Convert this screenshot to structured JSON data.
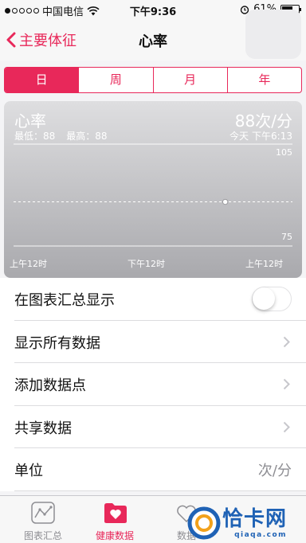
{
  "status_bar": {
    "carrier": "中国电信",
    "time": "下午9:36",
    "battery": "61%"
  },
  "nav": {
    "back_label": "主要体征",
    "title": "心率"
  },
  "segments": {
    "day": "日",
    "week": "周",
    "month": "月",
    "year": "年",
    "selected": "日"
  },
  "chart_card": {
    "title": "心率",
    "min_label": "最低：88",
    "max_label": "最高：88",
    "value": "88",
    "unit": "次/分",
    "date": "今天",
    "time": "下午6:13"
  },
  "chart_data": {
    "type": "scatter",
    "title": "心率",
    "xlabel": "",
    "ylabel": "",
    "x_ticks": [
      "上午12时",
      "下午12时",
      "上午12时"
    ],
    "ylim": [
      75,
      105
    ],
    "y_ticks": [
      "105",
      "75"
    ],
    "series": [
      {
        "name": "",
        "points": [
          {
            "x": "下午6:13",
            "y": 88
          }
        ]
      }
    ],
    "reference_line": 88,
    "grid": true,
    "colors": {
      "background_top": "#dedee0",
      "background_bottom": "#a9a9ad",
      "point": "#ffffff"
    }
  },
  "list": {
    "show_in_dashboard": "在图表汇总显示",
    "show_in_dashboard_on": false,
    "show_all_data": "显示所有数据",
    "add_data_point": "添加数据点",
    "share_data": "共享数据",
    "unit_label": "单位",
    "unit_value": "次/分"
  },
  "tabbar": {
    "dashboard": "图表汇总",
    "health_data": "健康数据",
    "sources": "数据",
    "active": "健康数据"
  },
  "watermark": {
    "text": "恰卡网",
    "url": "qiaqa.com"
  },
  "colors": {
    "accent": "#e8285a",
    "secondary_text": "#8e8e93",
    "watermark": "#1f62b5"
  }
}
